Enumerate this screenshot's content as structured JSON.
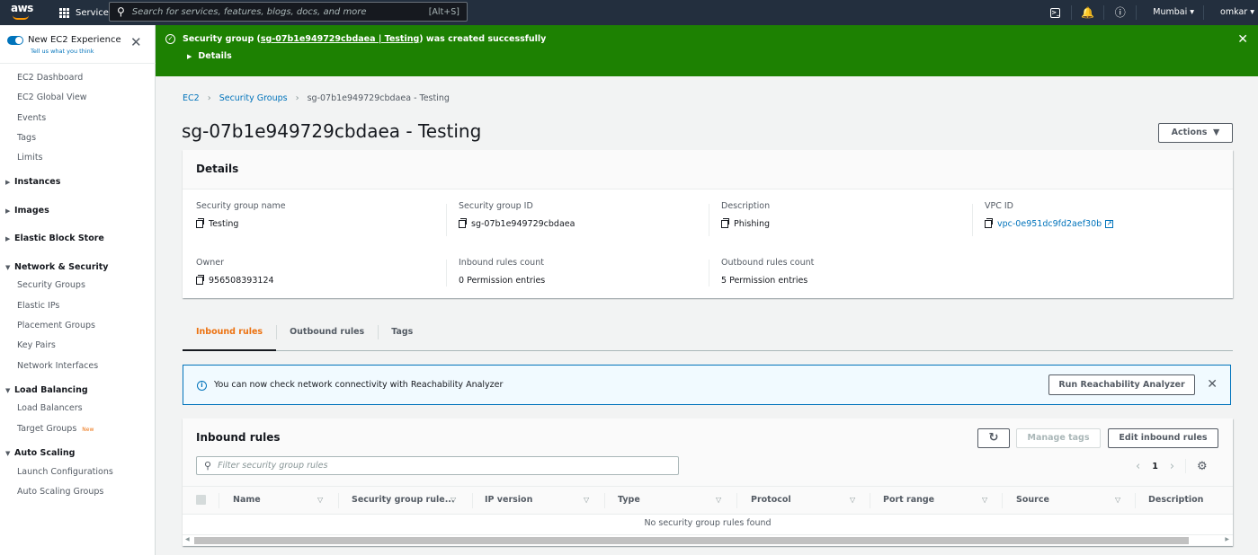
{
  "topnav": {
    "logo": "aws",
    "services_label": "Services",
    "search_placeholder": "Search for services, features, blogs, docs, and more",
    "search_shortcut": "[Alt+S]",
    "region": "Mumbai",
    "user": "omkar",
    "icons": [
      "cloudshell-icon",
      "bell-icon",
      "help-icon"
    ]
  },
  "sidebar": {
    "experience_title": "New EC2 Experience",
    "experience_sub": "Tell us what you think",
    "top_items": [
      "EC2 Dashboard",
      "EC2 Global View",
      "Events",
      "Tags",
      "Limits"
    ],
    "collapsed_sections": [
      "Instances",
      "Images",
      "Elastic Block Store"
    ],
    "network_security": {
      "label": "Network & Security",
      "items": [
        "Security Groups",
        "Elastic IPs",
        "Placement Groups",
        "Key Pairs",
        "Network Interfaces"
      ]
    },
    "load_balancing": {
      "label": "Load Balancing",
      "items": [
        "Load Balancers",
        "Target Groups"
      ],
      "new_badge": "New"
    },
    "auto_scaling": {
      "label": "Auto Scaling",
      "items": [
        "Launch Configurations",
        "Auto Scaling Groups"
      ]
    }
  },
  "flash": {
    "prefix": "Security group (",
    "link": "sg-07b1e949729cbdaea | Testing",
    "suffix": ") was created successfully",
    "details_label": "Details",
    "color": "#1d8102"
  },
  "breadcrumb": {
    "items": [
      "EC2",
      "Security Groups"
    ],
    "current": "sg-07b1e949729cbdaea - Testing"
  },
  "page": {
    "title": "sg-07b1e949729cbdaea - Testing",
    "actions_label": "Actions"
  },
  "details": {
    "heading": "Details",
    "fields": {
      "sg_name": {
        "label": "Security group name",
        "value": "Testing"
      },
      "sg_id": {
        "label": "Security group ID",
        "value": "sg-07b1e949729cbdaea"
      },
      "description": {
        "label": "Description",
        "value": "Phishing"
      },
      "vpc_id": {
        "label": "VPC ID",
        "value": "vpc-0e951dc9fd2aef30b"
      },
      "owner": {
        "label": "Owner",
        "value": "956508393124"
      },
      "inbound_count": {
        "label": "Inbound rules count",
        "value": "0 Permission entries"
      },
      "outbound_count": {
        "label": "Outbound rules count",
        "value": "5 Permission entries"
      }
    }
  },
  "tabs": [
    {
      "label": "Inbound rules",
      "active": true
    },
    {
      "label": "Outbound rules",
      "active": false
    },
    {
      "label": "Tags",
      "active": false
    }
  ],
  "alert": {
    "text": "You can now check network connectivity with Reachability Analyzer",
    "button": "Run Reachability Analyzer"
  },
  "rules": {
    "title": "Inbound rules",
    "manage_tags": "Manage tags",
    "edit_rules": "Edit inbound rules",
    "filter_placeholder": "Filter security group rules",
    "page": "1",
    "columns": [
      "Name",
      "Security group rule...",
      "IP version",
      "Type",
      "Protocol",
      "Port range",
      "Source",
      "Description"
    ],
    "empty_text": "No security group rules found"
  }
}
